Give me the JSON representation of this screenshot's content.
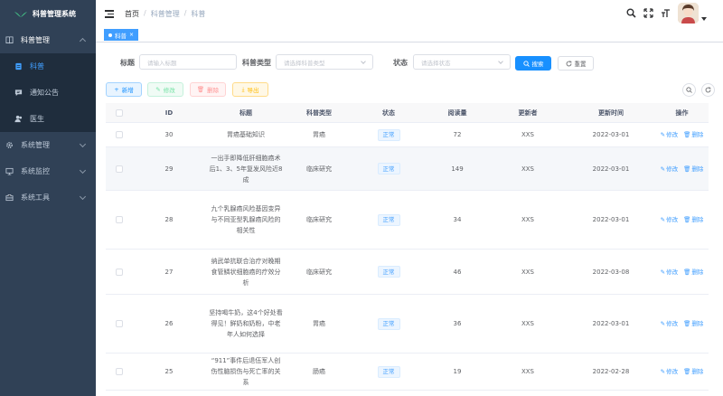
{
  "app": {
    "title": "科普管理系统"
  },
  "sidebar": {
    "groups": [
      {
        "label": "科普管理",
        "icon": "book-icon",
        "expanded": true,
        "items": [
          {
            "label": "科普",
            "icon": "document-icon",
            "active": true
          },
          {
            "label": "通知公告",
            "icon": "message-icon"
          },
          {
            "label": "医生",
            "icon": "user-icon"
          }
        ]
      },
      {
        "label": "系统管理",
        "icon": "gear-icon"
      },
      {
        "label": "系统监控",
        "icon": "monitor-icon"
      },
      {
        "label": "系统工具",
        "icon": "toolbox-icon"
      }
    ]
  },
  "breadcrumb": [
    "首页",
    "科普管理",
    "科普"
  ],
  "tags": [
    {
      "label": "科普",
      "active": true
    }
  ],
  "search": {
    "title_label": "标题",
    "title_placeholder": "请输入标题",
    "type_label": "科普类型",
    "type_placeholder": "请选择科普类型",
    "status_label": "状态",
    "status_placeholder": "请选择状态",
    "search_button": "搜索",
    "reset_button": "重置"
  },
  "toolbar": {
    "add": "新增",
    "edit": "修改",
    "delete": "删除",
    "export": "导出"
  },
  "table": {
    "columns": [
      "ID",
      "标题",
      "科普类型",
      "状态",
      "阅读量",
      "更新者",
      "更新时间",
      "操作"
    ],
    "rows": [
      {
        "id": "30",
        "title": "胃癌基础知识",
        "type": "胃癌",
        "status": "正常",
        "reads": "72",
        "updater": "XXS",
        "time": "2022-03-01"
      },
      {
        "id": "29",
        "title": "一出手即降低肝细胞癌术后1、3、5年复发风险近8成",
        "type": "临床研究",
        "status": "正常",
        "reads": "149",
        "updater": "XXS",
        "time": "2022-03-01"
      },
      {
        "id": "28",
        "title": "九个乳腺癌风险基因变异与不同亚型乳腺癌风险的相关性",
        "type": "临床研究",
        "status": "正常",
        "reads": "34",
        "updater": "XXS",
        "time": "2022-03-01"
      },
      {
        "id": "27",
        "title": "纳武单抗联合治疗对晚期食管鳞状细胞癌的疗效分析",
        "type": "临床研究",
        "status": "正常",
        "reads": "46",
        "updater": "XXS",
        "time": "2022-03-08"
      },
      {
        "id": "26",
        "title": "坚持喝牛奶，这4个好处看得见！鲜奶和奶粉，中老年人如何选择",
        "type": "胃癌",
        "status": "正常",
        "reads": "36",
        "updater": "XXS",
        "time": "2022-03-01"
      },
      {
        "id": "25",
        "title": "“911”事件后退伍军人创伤性脑损伤与死亡率的关系",
        "type": "肠癌",
        "status": "正常",
        "reads": "19",
        "updater": "XXS",
        "time": "2022-02-28"
      }
    ],
    "ops": {
      "edit": "修改",
      "delete": "删除"
    }
  },
  "colors": {
    "sidebar_bg": "#304156",
    "primary": "#409eff",
    "active_tag": "#409eff"
  }
}
